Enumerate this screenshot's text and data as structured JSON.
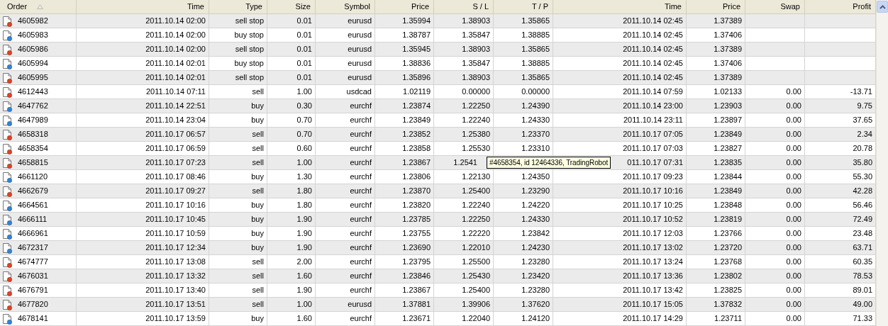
{
  "columns": [
    {
      "label": "Order",
      "sorted": true
    },
    {
      "label": "Time",
      "sorted": false
    },
    {
      "label": "Type",
      "sorted": false
    },
    {
      "label": "Size",
      "sorted": false
    },
    {
      "label": "Symbol",
      "sorted": false
    },
    {
      "label": "Price",
      "sorted": false
    },
    {
      "label": "S / L",
      "sorted": false
    },
    {
      "label": "T / P",
      "sorted": false
    },
    {
      "label": "Time",
      "sorted": false
    },
    {
      "label": "Price",
      "sorted": false
    },
    {
      "label": "Swap",
      "sorted": false
    },
    {
      "label": "Profit",
      "sorted": false
    }
  ],
  "rows": [
    {
      "order": "4605982",
      "kind": "sell",
      "cells": [
        "2011.10.14 02:00",
        "sell stop",
        "0.01",
        "eurusd",
        "1.35994",
        "1.38903",
        "1.35865",
        "2011.10.14 02:45",
        "1.37389",
        null,
        null
      ]
    },
    {
      "order": "4605983",
      "kind": "buy",
      "cells": [
        "2011.10.14 02:00",
        "buy stop",
        "0.01",
        "eurusd",
        "1.38787",
        "1.35847",
        "1.38885",
        "2011.10.14 02:45",
        "1.37406",
        null,
        null
      ]
    },
    {
      "order": "4605986",
      "kind": "sell",
      "cells": [
        "2011.10.14 02:00",
        "sell stop",
        "0.01",
        "eurusd",
        "1.35945",
        "1.38903",
        "1.35865",
        "2011.10.14 02:45",
        "1.37389",
        null,
        null
      ]
    },
    {
      "order": "4605994",
      "kind": "buy",
      "cells": [
        "2011.10.14 02:01",
        "buy stop",
        "0.01",
        "eurusd",
        "1.38836",
        "1.35847",
        "1.38885",
        "2011.10.14 02:45",
        "1.37406",
        null,
        null
      ]
    },
    {
      "order": "4605995",
      "kind": "sell",
      "cells": [
        "2011.10.14 02:01",
        "sell stop",
        "0.01",
        "eurusd",
        "1.35896",
        "1.38903",
        "1.35865",
        "2011.10.14 02:45",
        "1.37389",
        null,
        null
      ]
    },
    {
      "order": "4612443",
      "kind": "sell",
      "cells": [
        "2011.10.14 07:11",
        "sell",
        "1.00",
        "usdcad",
        "1.02119",
        "0.00000",
        "0.00000",
        "2011.10.14 07:59",
        "1.02133",
        "0.00",
        "-13.71"
      ]
    },
    {
      "order": "4647762",
      "kind": "buy",
      "cells": [
        "2011.10.14 22:51",
        "buy",
        "0.30",
        "eurchf",
        "1.23874",
        "1.22250",
        "1.24390",
        "2011.10.14 23:00",
        "1.23903",
        "0.00",
        "9.75"
      ]
    },
    {
      "order": "4647989",
      "kind": "buy",
      "cells": [
        "2011.10.14 23:04",
        "buy",
        "0.70",
        "eurchf",
        "1.23849",
        "1.22240",
        "1.24330",
        "2011.10.14 23:11",
        "1.23897",
        "0.00",
        "37.65"
      ]
    },
    {
      "order": "4658318",
      "kind": "sell",
      "cells": [
        "2011.10.17 06:57",
        "sell",
        "0.70",
        "eurchf",
        "1.23852",
        "1.25380",
        "1.23370",
        "2011.10.17 07:05",
        "1.23849",
        "0.00",
        "2.34"
      ]
    },
    {
      "order": "4658354",
      "kind": "sell",
      "cells": [
        "2011.10.17 06:59",
        "sell",
        "0.60",
        "eurchf",
        "1.23858",
        "1.25530",
        "1.23310",
        "2011.10.17 07:03",
        "1.23827",
        "0.00",
        "20.78"
      ]
    },
    {
      "order": "4658815",
      "kind": "sell",
      "tooltip": "#4658354, id 12464336, TradingRobot",
      "cells": [
        "2011.10.17 07:23",
        "sell",
        "1.00",
        "eurchf",
        "1.23867",
        "1.2541",
        null,
        "011.10.17 07:31",
        "1.23835",
        "0.00",
        "35.80"
      ]
    },
    {
      "order": "4661120",
      "kind": "buy",
      "cells": [
        "2011.10.17 08:46",
        "buy",
        "1.30",
        "eurchf",
        "1.23806",
        "1.22130",
        "1.24350",
        "2011.10.17 09:23",
        "1.23844",
        "0.00",
        "55.30"
      ]
    },
    {
      "order": "4662679",
      "kind": "sell",
      "cells": [
        "2011.10.17 09:27",
        "sell",
        "1.80",
        "eurchf",
        "1.23870",
        "1.25400",
        "1.23290",
        "2011.10.17 10:16",
        "1.23849",
        "0.00",
        "42.28"
      ]
    },
    {
      "order": "4664561",
      "kind": "buy",
      "cells": [
        "2011.10.17 10:16",
        "buy",
        "1.80",
        "eurchf",
        "1.23820",
        "1.22240",
        "1.24220",
        "2011.10.17 10:25",
        "1.23848",
        "0.00",
        "56.46"
      ]
    },
    {
      "order": "4666111",
      "kind": "buy",
      "cells": [
        "2011.10.17 10:45",
        "buy",
        "1.90",
        "eurchf",
        "1.23785",
        "1.22250",
        "1.24330",
        "2011.10.17 10:52",
        "1.23819",
        "0.00",
        "72.49"
      ]
    },
    {
      "order": "4666961",
      "kind": "buy",
      "cells": [
        "2011.10.17 10:59",
        "buy",
        "1.90",
        "eurchf",
        "1.23755",
        "1.22220",
        "1.23842",
        "2011.10.17 12:03",
        "1.23766",
        "0.00",
        "23.48"
      ]
    },
    {
      "order": "4672317",
      "kind": "buy",
      "cells": [
        "2011.10.17 12:34",
        "buy",
        "1.90",
        "eurchf",
        "1.23690",
        "1.22010",
        "1.24230",
        "2011.10.17 13:02",
        "1.23720",
        "0.00",
        "63.71"
      ]
    },
    {
      "order": "4674777",
      "kind": "sell",
      "cells": [
        "2011.10.17 13:08",
        "sell",
        "2.00",
        "eurchf",
        "1.23795",
        "1.25500",
        "1.23280",
        "2011.10.17 13:24",
        "1.23768",
        "0.00",
        "60.35"
      ]
    },
    {
      "order": "4676031",
      "kind": "sell",
      "cells": [
        "2011.10.17 13:32",
        "sell",
        "1.60",
        "eurchf",
        "1.23846",
        "1.25430",
        "1.23420",
        "2011.10.17 13:36",
        "1.23802",
        "0.00",
        "78.53"
      ]
    },
    {
      "order": "4676791",
      "kind": "sell",
      "cells": [
        "2011.10.17 13:40",
        "sell",
        "1.90",
        "eurchf",
        "1.23867",
        "1.25400",
        "1.23280",
        "2011.10.17 13:42",
        "1.23825",
        "0.00",
        "89.01"
      ]
    },
    {
      "order": "4677820",
      "kind": "sell",
      "cells": [
        "2011.10.17 13:51",
        "sell",
        "1.00",
        "eurusd",
        "1.37881",
        "1.39906",
        "1.37620",
        "2011.10.17 15:05",
        "1.37832",
        "0.00",
        "49.00"
      ]
    },
    {
      "order": "4678141",
      "kind": "buy",
      "cells": [
        "2011.10.17 13:59",
        "buy",
        "1.60",
        "eurchf",
        "1.23671",
        "1.22040",
        "1.24120",
        "2011.10.17 14:29",
        "1.23711",
        "0.00",
        "71.33"
      ]
    }
  ]
}
